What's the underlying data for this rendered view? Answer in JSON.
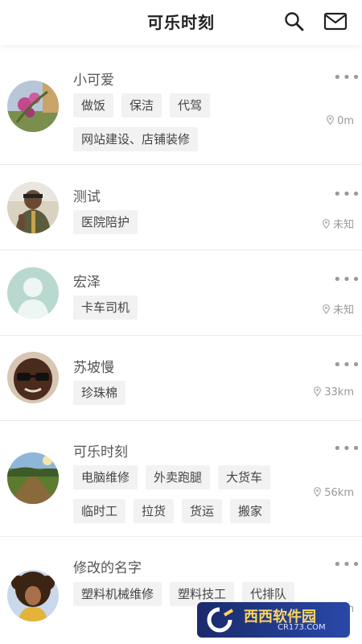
{
  "header": {
    "title": "可乐时刻",
    "icons": [
      "search-icon",
      "mail-icon"
    ]
  },
  "more_glyph": "•••",
  "users": [
    {
      "name": "小可爱",
      "tags": [
        "做饭",
        "保洁",
        "代驾",
        "网站建设、店铺装修"
      ],
      "distance": "0m",
      "avatar": "flower-photo"
    },
    {
      "name": "测试",
      "tags": [
        "医院陪护"
      ],
      "distance": "未知",
      "avatar": "person-photo"
    },
    {
      "name": "宏泽",
      "tags": [
        "卡车司机"
      ],
      "distance": "未知",
      "avatar": "default-avatar"
    },
    {
      "name": "苏坡慢",
      "tags": [
        "珍珠棉"
      ],
      "distance": "33km",
      "avatar": "sunglasses-photo"
    },
    {
      "name": "可乐时刻",
      "tags": [
        "电脑维修",
        "外卖跑腿",
        "大货车",
        "临时工",
        "拉货",
        "货运",
        "搬家"
      ],
      "distance": "56km",
      "avatar": "landscape-photo"
    },
    {
      "name": "修改的名字",
      "tags": [
        "塑料机械维修",
        "塑料技工",
        "代排队"
      ],
      "distance": "105km",
      "avatar": "curly-hair-photo"
    }
  ],
  "watermark": {
    "main": "西西软件园",
    "sub": "CR173.COM"
  }
}
